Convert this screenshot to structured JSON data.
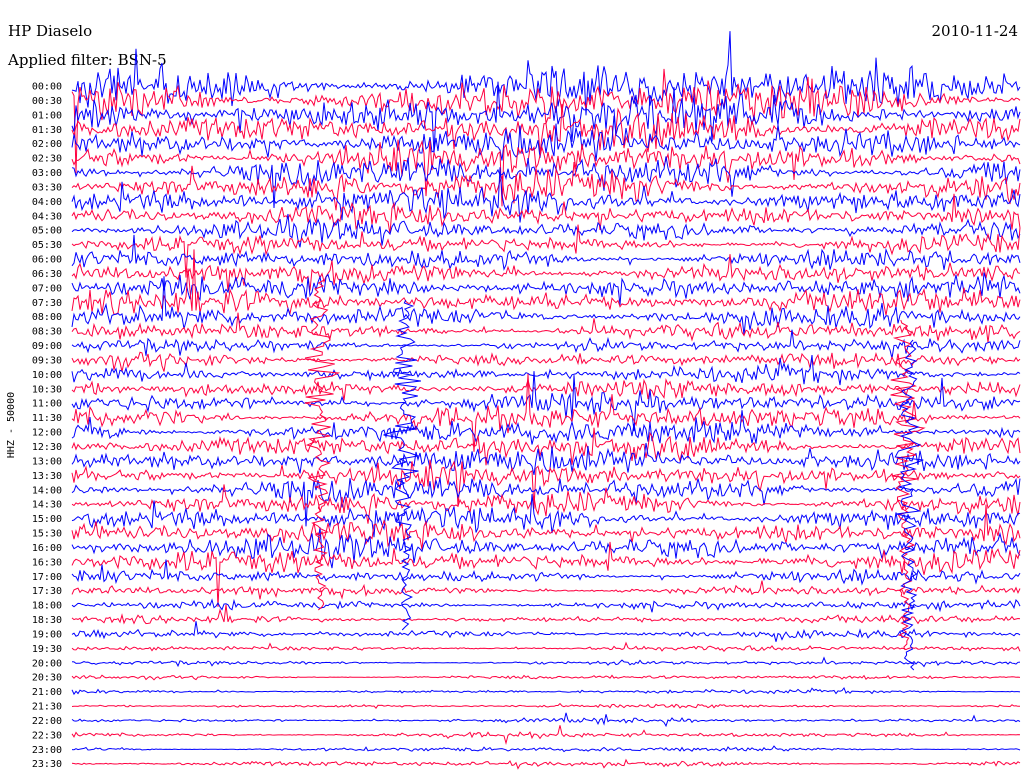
{
  "header": {
    "station": "HP Diaselo",
    "date": "2010-11-24",
    "filter": "Applied filter: BSN-5"
  },
  "chart_data": {
    "type": "line",
    "title": "",
    "ylabel": "HHZ - 50000",
    "tick_labels": [
      "00:00",
      "00:30",
      "01:00",
      "01:30",
      "02:00",
      "02:30",
      "03:00",
      "03:30",
      "04:00",
      "04:30",
      "05:00",
      "05:30",
      "06:00",
      "06:30",
      "07:00",
      "07:30",
      "08:00",
      "08:30",
      "09:00",
      "09:30",
      "10:00",
      "10:30",
      "11:00",
      "11:30",
      "12:00",
      "12:30",
      "13:00",
      "13:30",
      "14:00",
      "14:30",
      "15:00",
      "15:30",
      "16:00",
      "16:30",
      "17:00",
      "17:30",
      "18:00",
      "18:30",
      "19:00",
      "19:30",
      "20:00",
      "20:30",
      "21:00",
      "21:30",
      "22:00",
      "22:30",
      "23:00",
      "23:30"
    ],
    "trace_colors": [
      "#0000ff",
      "#ff0040"
    ],
    "amplitude_by_half_hour": [
      3.6,
      3.4,
      3.2,
      3.0,
      2.8,
      2.7,
      2.6,
      2.5,
      2.2,
      2.0,
      1.7,
      1.5,
      1.6,
      1.8,
      1.9,
      2.0,
      1.8,
      1.4,
      1.1,
      1.2,
      1.3,
      1.5,
      1.7,
      1.9,
      2.0,
      2.1,
      2.2,
      2.0,
      2.1,
      1.9,
      1.8,
      1.9,
      2.0,
      1.8,
      1.0,
      0.8,
      0.7,
      0.6,
      0.65,
      0.4,
      0.35,
      0.3,
      0.3,
      0.28,
      0.35,
      0.4,
      0.35,
      0.45
    ],
    "grid": false,
    "legend": "none"
  },
  "colors": {
    "trace_a": "#0000ff",
    "trace_b": "#ff0040",
    "background": "#ffffff",
    "text": "#000000"
  }
}
